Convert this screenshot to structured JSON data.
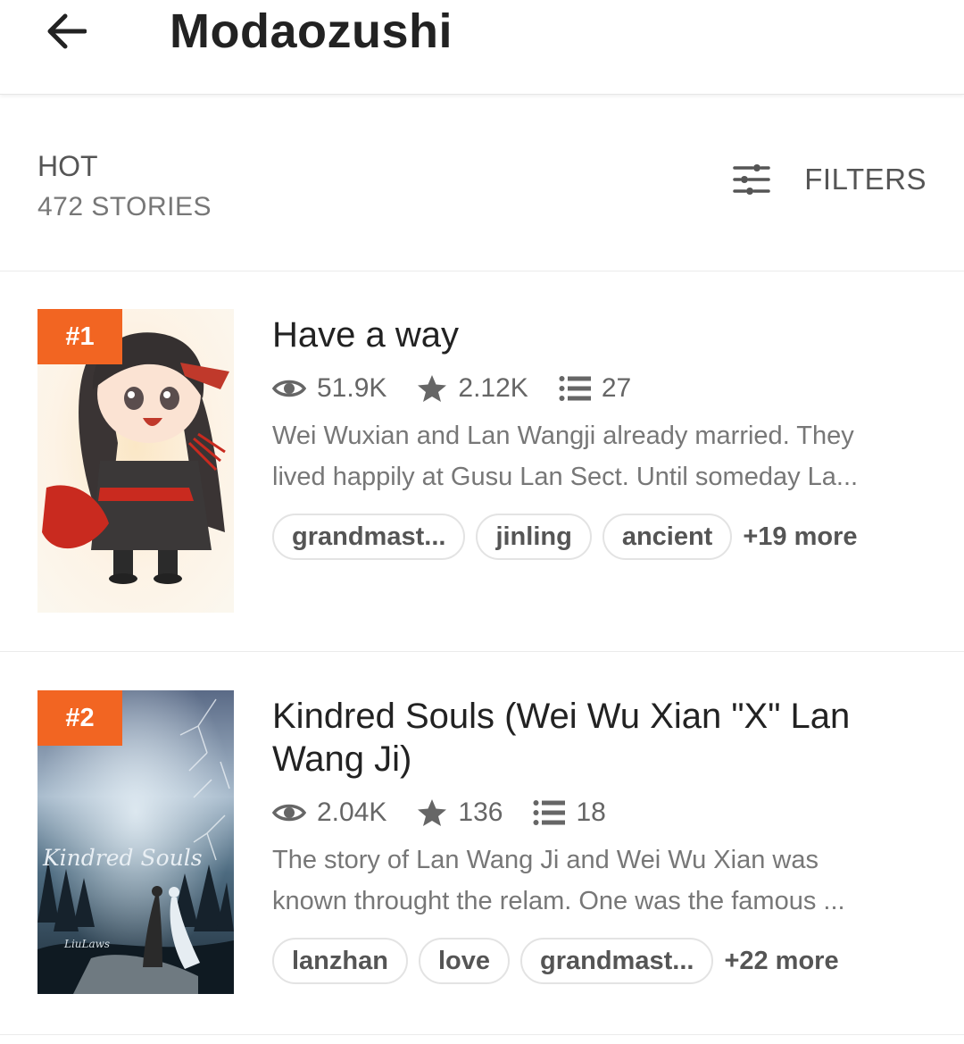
{
  "appbar": {
    "title": "Modaozushi"
  },
  "list_header": {
    "category": "HOT",
    "count": "472 STORIES",
    "filters_label": "FILTERS"
  },
  "colors": {
    "rank_badge": "#f26522",
    "text_primary": "#222222",
    "text_secondary": "#777777"
  },
  "stories": [
    {
      "rank": "#1",
      "title": "Have a way",
      "reads": "51.9K",
      "votes": "2.12K",
      "parts": "27",
      "description_lines": [
        "Wei Wuxian and Lan Wangji already married. They",
        "lived happily at Gusu Lan Sect. Until someday La..."
      ],
      "tags": [
        "grandmast...",
        "jinling",
        "ancient"
      ],
      "more_tags": "+19 more"
    },
    {
      "rank": "#2",
      "title": "Kindred Souls (Wei Wu Xian \"X\" Lan Wang Ji)",
      "reads": "2.04K",
      "votes": "136",
      "parts": "18",
      "cover_text": "Kindred Souls",
      "cover_signature": "LiuLaws",
      "description_lines": [
        "The story of Lan Wang Ji and Wei Wu Xian was",
        "known throught the relam. One was the famous ..."
      ],
      "tags": [
        "lanzhan",
        "love",
        "grandmast..."
      ],
      "more_tags": "+22 more"
    }
  ],
  "icons": [
    "back-arrow-icon",
    "filters-sliders-icon",
    "eye-icon",
    "star-icon",
    "list-icon"
  ]
}
